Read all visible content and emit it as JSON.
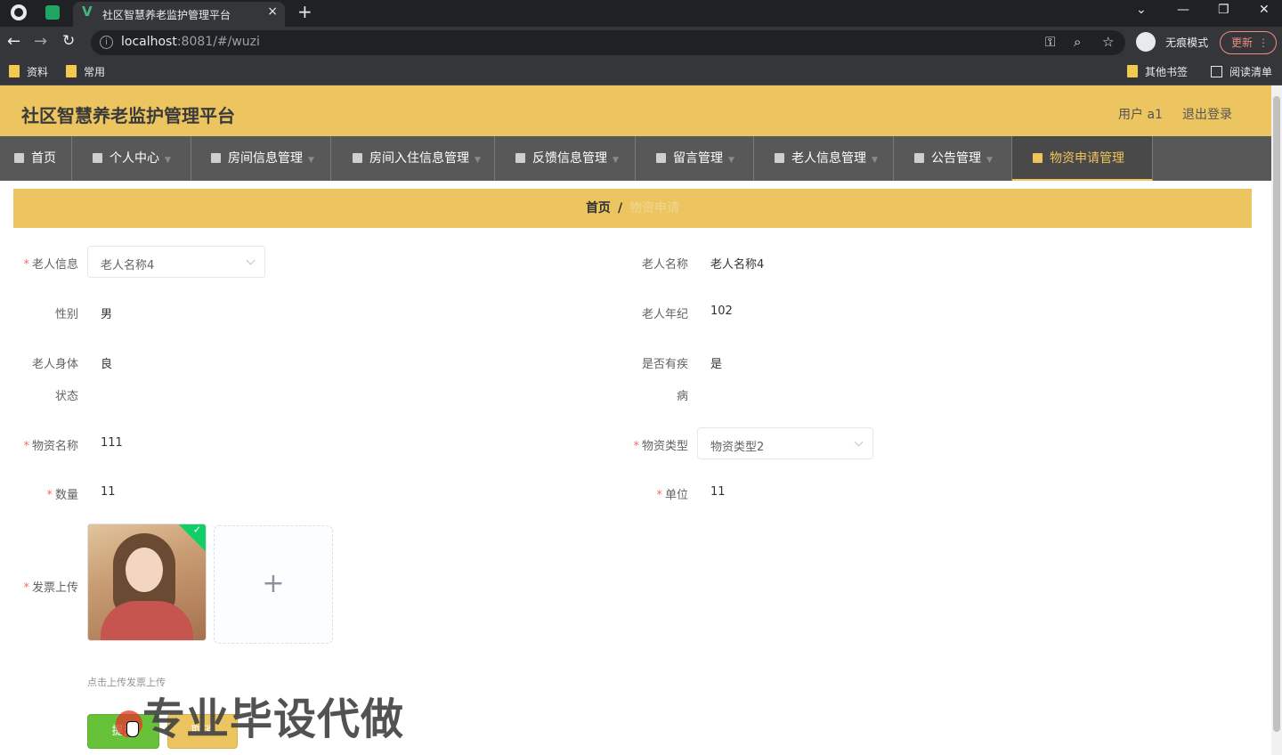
{
  "browser": {
    "tab_title": "社区智慧养老监护管理平台",
    "tab_close": "×",
    "new_tab": "+",
    "url_host": "localhost",
    "url_rest": ":8081/#/wuzi",
    "incognito_label": "无痕模式",
    "update_label": "更新",
    "bookmarks": [
      "资料",
      "常用"
    ],
    "other_bookmarks": "其他书签",
    "reading_list": "阅读清单"
  },
  "header": {
    "title": "社区智慧养老监护管理平台",
    "user_label": "用户 a1",
    "logout_label": "退出登录"
  },
  "menu": {
    "items": [
      {
        "label": "首页"
      },
      {
        "label": "个人中心"
      },
      {
        "label": "房间信息管理"
      },
      {
        "label": "房间入住信息管理"
      },
      {
        "label": "反馈信息管理"
      },
      {
        "label": "留言管理"
      },
      {
        "label": "老人信息管理"
      },
      {
        "label": "公告管理"
      },
      {
        "label": "物资申请管理"
      }
    ],
    "active_index": 8
  },
  "breadcrumb": {
    "home": "首页",
    "separator": "/",
    "current": "物资申请"
  },
  "form": {
    "elder_info": {
      "label": "老人信息",
      "value": "老人名称4"
    },
    "elder_name": {
      "label": "老人名称",
      "value": "老人名称4"
    },
    "gender": {
      "label": "性别",
      "value": "男"
    },
    "age": {
      "label": "老人年纪",
      "value": "102"
    },
    "health": {
      "label_line1": "老人身体",
      "label_line2": "状态",
      "value": "良"
    },
    "disease": {
      "label_line1": "是否有疾",
      "label_line2": "病",
      "value": "是"
    },
    "material_name": {
      "label": "物资名称",
      "value": "111"
    },
    "material_type": {
      "label": "物资类型",
      "value": "物资类型2"
    },
    "quantity": {
      "label": "数量",
      "value": "11"
    },
    "unit": {
      "label": "单位",
      "value": "11"
    },
    "invoice": {
      "label": "发票上传",
      "hint": "点击上传发票上传",
      "add_symbol": "+"
    },
    "submit_label": "提交",
    "cancel_label": "取消"
  },
  "watermark": "专业毕设代做",
  "colors": {
    "header_bg": "#ecc560",
    "menu_bg": "#595858",
    "menu_active_text": "#f0c35b",
    "required": "#f56c6c",
    "submit_bg": "#67c23a"
  }
}
